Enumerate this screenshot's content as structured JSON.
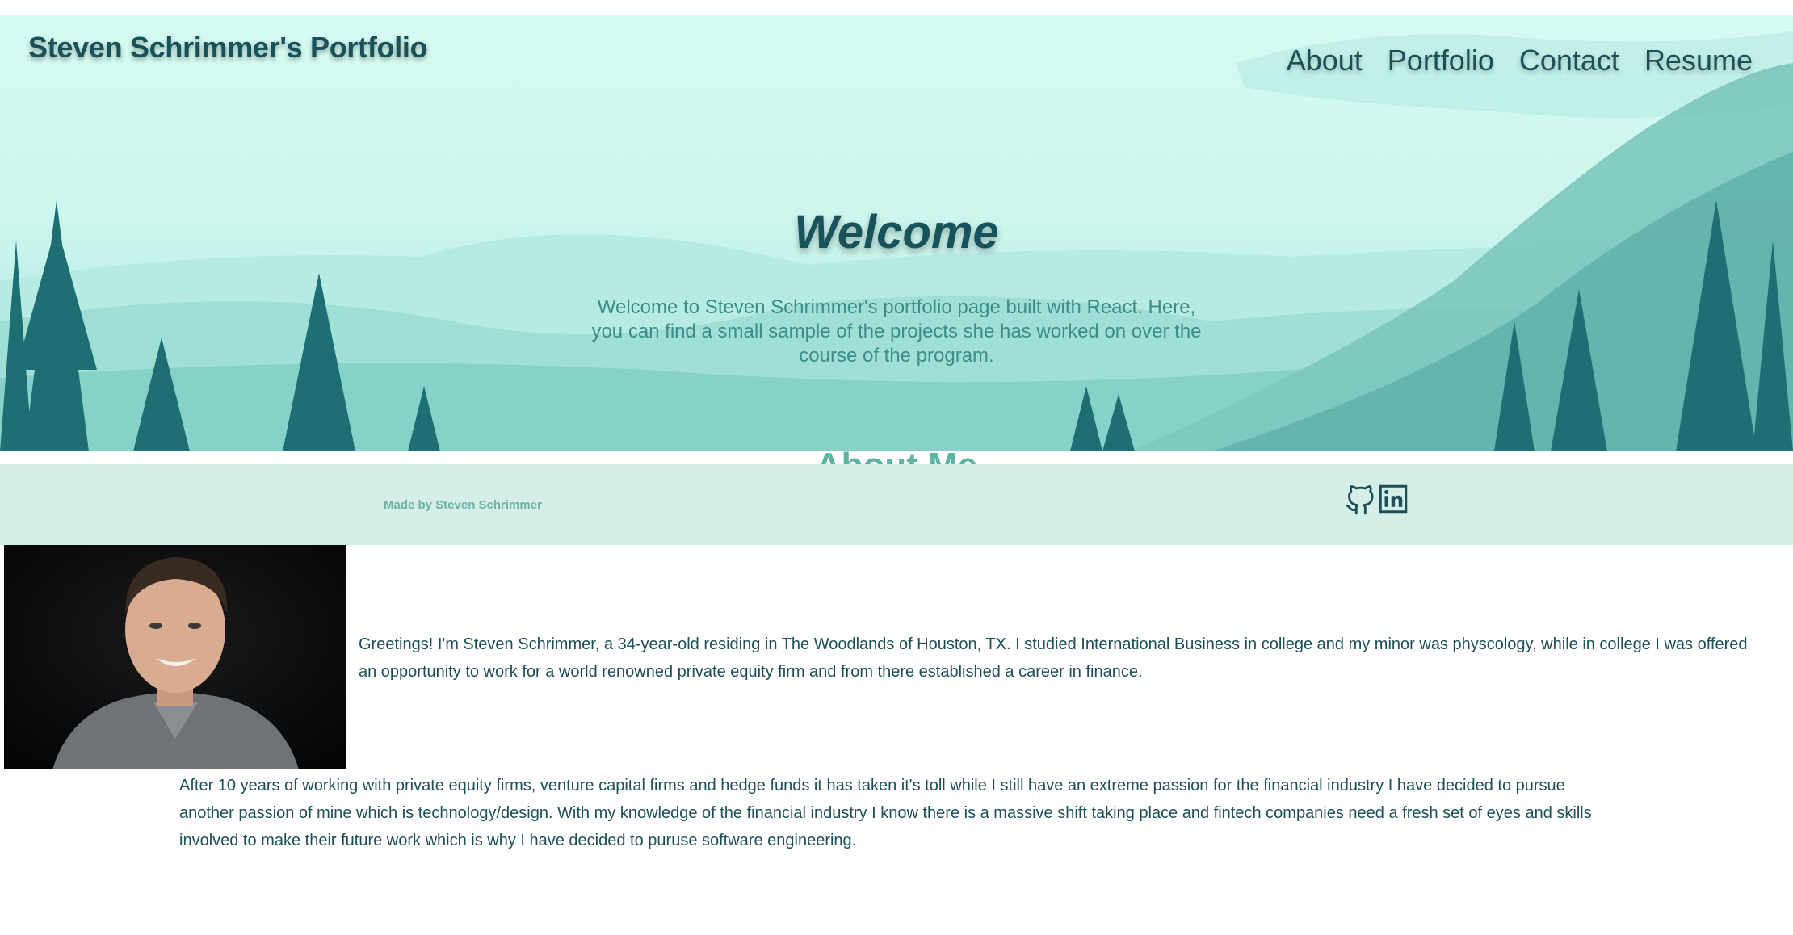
{
  "header": {
    "title": "Steven Schrimmer's Portfolio",
    "nav": [
      "About",
      "Portfolio",
      "Contact",
      "Resume"
    ]
  },
  "hero": {
    "heading": "Welcome",
    "text": "Welcome to Steven Schrimmer's portfolio page built with React. Here, you can find a small sample of the projects she has worked on over the course of the program."
  },
  "section_peek": "About Me",
  "footer": {
    "credit": "Made by Steven Schrimmer",
    "icons": [
      "github-icon",
      "linkedin-icon"
    ]
  },
  "about": {
    "paragraph1": "Greetings! I'm Steven Schrimmer, a 34-year-old residing in The Woodlands of Houston, TX. I studied International Business in college and my minor was physcology, while in college I was offered an opportunity to work for a world renowned private equity firm and from there established a career in finance.",
    "paragraph2": "After 10 years of working with private equity firms, venture capital firms and hedge funds it has taken it's toll while I still have an extreme passion for the financial industry I have decided to pursue another passion of mine which is technology/design. With my knowledge of the financial industry I know there is a massive shift taking place and fintech companies need a fresh set of eyes and skills involved to make their future work which is why I have decided to puruse software engineering."
  },
  "colors": {
    "primary": "#17525a",
    "hero_light": "#d6fbf3",
    "footer_bg": "#d5eee7",
    "accent": "#5bb5a2"
  }
}
